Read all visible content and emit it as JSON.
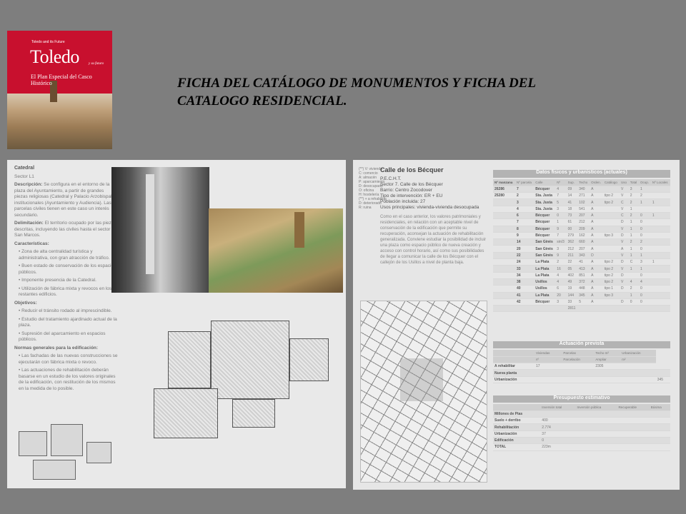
{
  "cover": {
    "series": "Toledo and its Future",
    "brand": "Toledo",
    "brand_sub": "y su futuro",
    "subtitle": "El Plan Especial del Casco Histórico"
  },
  "heading": {
    "line1": "FICHA DEL CATÁLOGO DE MONUMENTOS Y FICHA DEL",
    "line2": "CATALOGO RESIDENCIAL."
  },
  "left_page": {
    "title": "Catedral",
    "sector": "Sector L1",
    "descripcion_label": "Descripción:",
    "descripcion": " Se configura en el entorno de la plaza del Ayuntamiento, a partir de grandes piezas religiosas (Catedral y Palacio Arzobispal) e institucionales (Ayuntamiento y Audiencia). Las parcelas civiles tienen en este caso un interés secundario.",
    "delimitacion_label": "Delimitación:",
    "delimitacion": " El territorio ocupado por las piezas descritas, incluyendo las civiles hasta el sector de San Marcos.",
    "caracteristicas_label": "Características:",
    "caracteristicas": [
      "Zona de alta centralidad turística y administrativa, con gran atracción de tráfico.",
      "Buen estado de conservación de los espacios públicos.",
      "Imponente presencia de la Catedral.",
      "Utilización de fábrica mixta y revocos en los restantes edificios."
    ],
    "objetivos_label": "Objetivos:",
    "objetivos": [
      "Reducir el tránsito rodado al imprescindible.",
      "Estudio del tratamiento ajardinado actual de la plaza.",
      "Supresión del aparcamiento en espacios públicos."
    ],
    "normas_label": "Normas generales para la edificación:",
    "normas": [
      "Las fachadas de las nuevas construcciones se ejecutarán con fábrica mixta o revoco.",
      "Las actuaciones de rehabilitación deberán basarse en un estudio de los valores originales de la edificación, con restitución de los mismos en la medida de lo posible."
    ]
  },
  "right_page": {
    "legend": [
      "(**) V: vivienda",
      "C: comercio",
      "A: almacén",
      "P: aparcamiento",
      "D: desocupado",
      "O: oficina",
      "H: hostelería",
      "(**) + a rehabilitar",
      "D: deteriorado",
      "R: ruina"
    ],
    "title": "Calle de los Bécquer",
    "meta": [
      "P.E.C.H.T.",
      "Sector 7. Calle de los Bécquer",
      "Barrio: Centro Zocodover",
      "Tipo de intervención: ER + EU",
      "Población incluida: 27",
      "Usos principales: vivienda-vivienda desocupada"
    ],
    "desc": "Como en el caso anterior, los valores patrimoniales y residenciales, en relación con un aceptable nivel de conservación de la edificación que permite su recuperación, aconsejan la actuación de rehabilitación generalizada. Conviene estudiar la posibilidad de incluir una plaza como espacio público de nueva creación y acceso con control horario, así como sus posibilidades de llegar a comunicar la calle de los Bécquer con el callejón de los Usillos a nivel de planta baja.",
    "datos_title": "Datos físicos y urbanísticos (actuales)",
    "datos_header": [
      "Nº manzana",
      "Nº parcela",
      "Calle",
      "Nº",
      "Sup.",
      "Techo",
      "Orden.",
      "Catálogo",
      "Uso",
      "Total",
      "Ocup.",
      "Nº Locales"
    ],
    "datos_rows": [
      [
        "26286",
        "7",
        "Bécquer",
        "4",
        "09",
        "340",
        "A",
        "",
        "V",
        "3",
        "1",
        ""
      ],
      [
        "25280",
        "2",
        "Sta. Justa",
        "7",
        "14",
        "271",
        "A",
        "tipo 2",
        "V",
        "2",
        "2",
        ""
      ],
      [
        "",
        "3",
        "Sta. Justa",
        "5",
        "41",
        "102",
        "A",
        "tipo 2",
        "C",
        "2",
        "1",
        "1"
      ],
      [
        "",
        "4",
        "Sta. Justa",
        "3",
        "18",
        "541",
        "A",
        "",
        "V",
        "1",
        "",
        ""
      ],
      [
        "",
        "6",
        "Bécquer",
        "0",
        "73",
        "207",
        "A",
        "",
        "C",
        "2",
        "0",
        "1"
      ],
      [
        "",
        "7",
        "Bécquer",
        "1",
        "61",
        "212",
        "A",
        "",
        "D",
        "1",
        "0",
        ""
      ],
      [
        "",
        "8",
        "Bécquer",
        "9",
        "00",
        "209",
        "A",
        "",
        "V",
        "1",
        "0",
        ""
      ],
      [
        "",
        "9",
        "Bécquer",
        "7",
        "279",
        "162",
        "A",
        "tipo 3",
        "D",
        "1",
        "0",
        ""
      ],
      [
        "",
        "14",
        "San Ginés",
        "sin/3",
        "362",
        "660",
        "A",
        "",
        "V",
        "2",
        "2",
        ""
      ],
      [
        "",
        "20",
        "San Ginés",
        "3",
        "212",
        "207",
        "A",
        "",
        "A",
        "1",
        "0",
        ""
      ],
      [
        "",
        "22",
        "San Ginés",
        "9",
        "211",
        "343",
        "D",
        "",
        "V",
        "1",
        "1",
        ""
      ],
      [
        "",
        "24",
        "La Plata",
        "2",
        "22",
        "41",
        "A",
        "tipo 2",
        "D",
        "C",
        "3",
        "1"
      ],
      [
        "",
        "33",
        "La Plata",
        "16",
        "05",
        "413",
        "A",
        "tipo 2",
        "V",
        "1",
        "1",
        ""
      ],
      [
        "",
        "34",
        "La Plata",
        "4",
        "402",
        "851",
        "A",
        "tipo 2",
        "D",
        "",
        "0",
        ""
      ],
      [
        "",
        "38",
        "Usillos",
        "4",
        "49",
        "372",
        "A",
        "tipo 2",
        "V",
        "4",
        "4",
        ""
      ],
      [
        "",
        "40",
        "Usillos",
        "6",
        "19",
        "448",
        "A",
        "tipo 1",
        "D",
        "2",
        "0",
        ""
      ],
      [
        "",
        "41",
        "La Plata",
        "20",
        "144",
        "345",
        "A",
        "tipo 3",
        "",
        "1",
        "0",
        ""
      ],
      [
        "",
        "42",
        "Bécquer",
        "3",
        "33",
        "5",
        "A",
        "",
        "D",
        "0",
        "0",
        ""
      ],
      [
        "",
        "",
        "",
        "",
        "2811",
        "",
        "",
        "",
        "",
        "",
        "",
        ""
      ]
    ],
    "actuacion_title": "Actuación prevista",
    "actuacion_header": [
      "Viviendas",
      "Parcelas",
      "Techo m²",
      "Urbanización"
    ],
    "actuacion_sub": [
      "nº",
      "Parcelación",
      "Ampliar",
      "m²"
    ],
    "actuacion_rows": [
      [
        "A rehabilitar",
        "17",
        "",
        "2305",
        "",
        ""
      ],
      [
        "Nueva planta",
        "",
        "",
        "",
        "",
        ""
      ],
      [
        "Urbanización",
        "",
        "",
        "",
        "",
        "345"
      ]
    ],
    "presupuesto_title": "Presupuesto estimativo",
    "presupuesto_header": [
      "Inversión total",
      "Inversión pública",
      "Recuperable",
      "Búsima"
    ],
    "presupuesto_unit": "Millones de Ptas",
    "presupuesto_rows": [
      [
        "Suelo + derribo",
        "400"
      ],
      [
        "Rehabilitación",
        "2.774"
      ],
      [
        "Urbanización",
        "37"
      ],
      [
        "Edificación",
        "0"
      ],
      [
        "TOTAL",
        "223m"
      ]
    ]
  }
}
